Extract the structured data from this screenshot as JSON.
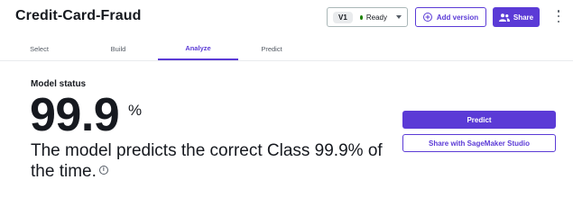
{
  "header": {
    "title": "Credit-Card-Fraud",
    "version": "V1",
    "status": "Ready",
    "status_color": "#1d8102",
    "add_version_label": "Add version",
    "share_label": "Share",
    "accent_color": "#5b3bd6"
  },
  "tabs": [
    {
      "label": "Select",
      "active": false
    },
    {
      "label": "Build",
      "active": false
    },
    {
      "label": "Analyze",
      "active": true
    },
    {
      "label": "Predict",
      "active": false
    }
  ],
  "model_status": {
    "label": "Model status",
    "value": "99.9",
    "unit": "%",
    "description": "The model predicts the correct Class 99.9% of the time."
  },
  "actions": {
    "predict_label": "Predict",
    "studio_label": "Share with SageMaker Studio"
  },
  "icons": [
    "plus-circle-icon",
    "people-icon",
    "more-vertical-icon",
    "info-icon",
    "chevron-down-icon"
  ]
}
